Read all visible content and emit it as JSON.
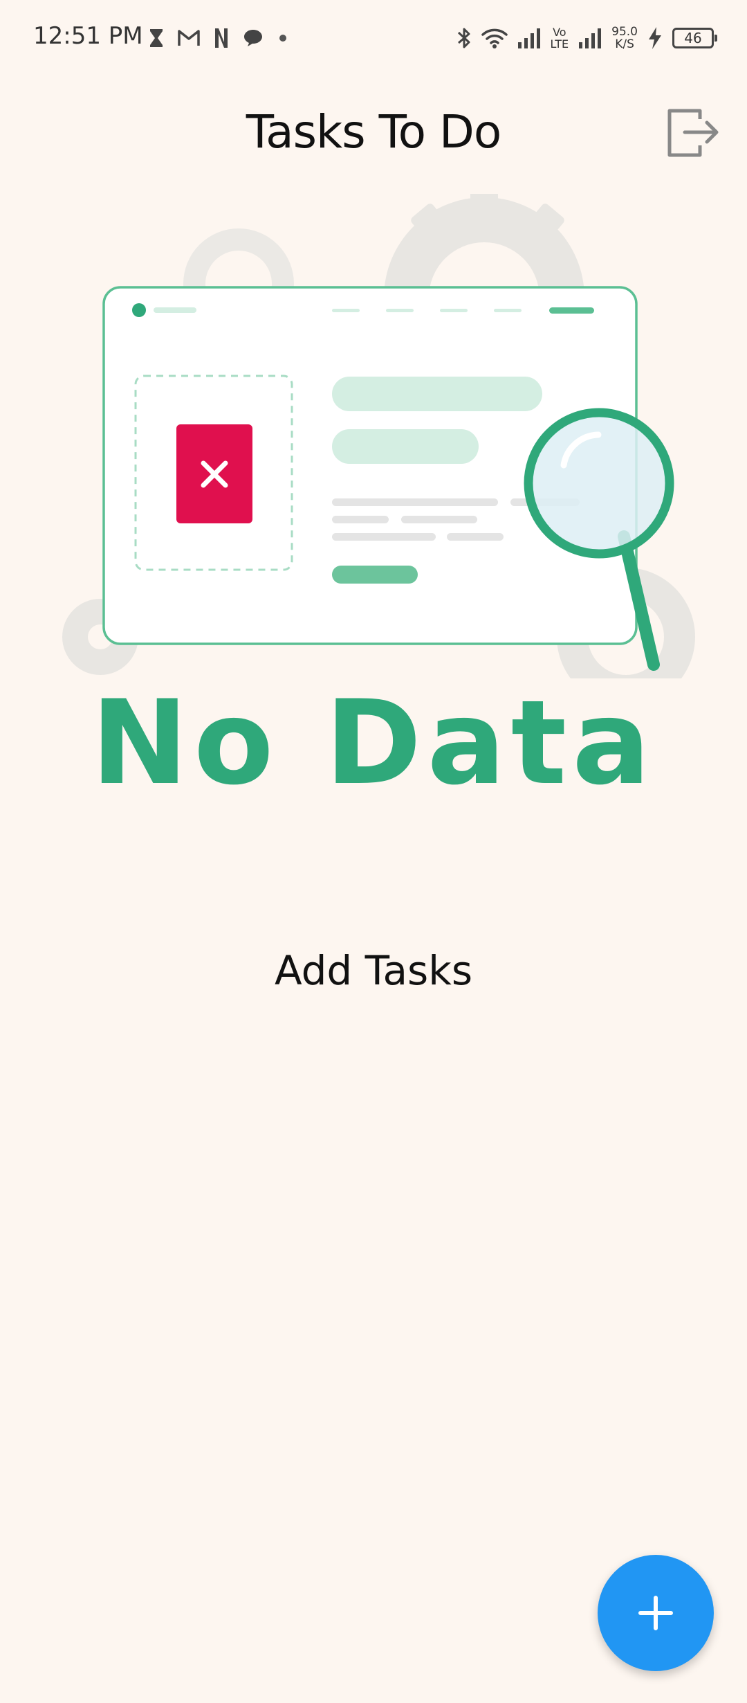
{
  "status_bar": {
    "time": "12:51 PM",
    "left_icons": [
      "hourglass-icon",
      "gmail-icon",
      "netflix-icon",
      "chat-bubble-icon",
      "dot-icon"
    ],
    "right_icons": [
      "bluetooth-icon",
      "wifi-icon",
      "signal-icon",
      "volte-icon",
      "signal-icon-2",
      "charging-icon"
    ],
    "volte_top": "Vo",
    "volte_bottom": "LTE",
    "net_speed_value": "95.0",
    "net_speed_unit": "K/S",
    "battery_level": "46"
  },
  "header": {
    "title": "Tasks To Do",
    "logout_icon": "logout-icon"
  },
  "empty_state": {
    "illustration_text": "No Data",
    "message": "Add Tasks"
  },
  "fab": {
    "icon": "plus-icon"
  },
  "colors": {
    "background": "#fdf6f0",
    "accent_green": "#2fa87a",
    "fab_blue": "#2196f3",
    "error_red": "#e0104e"
  }
}
